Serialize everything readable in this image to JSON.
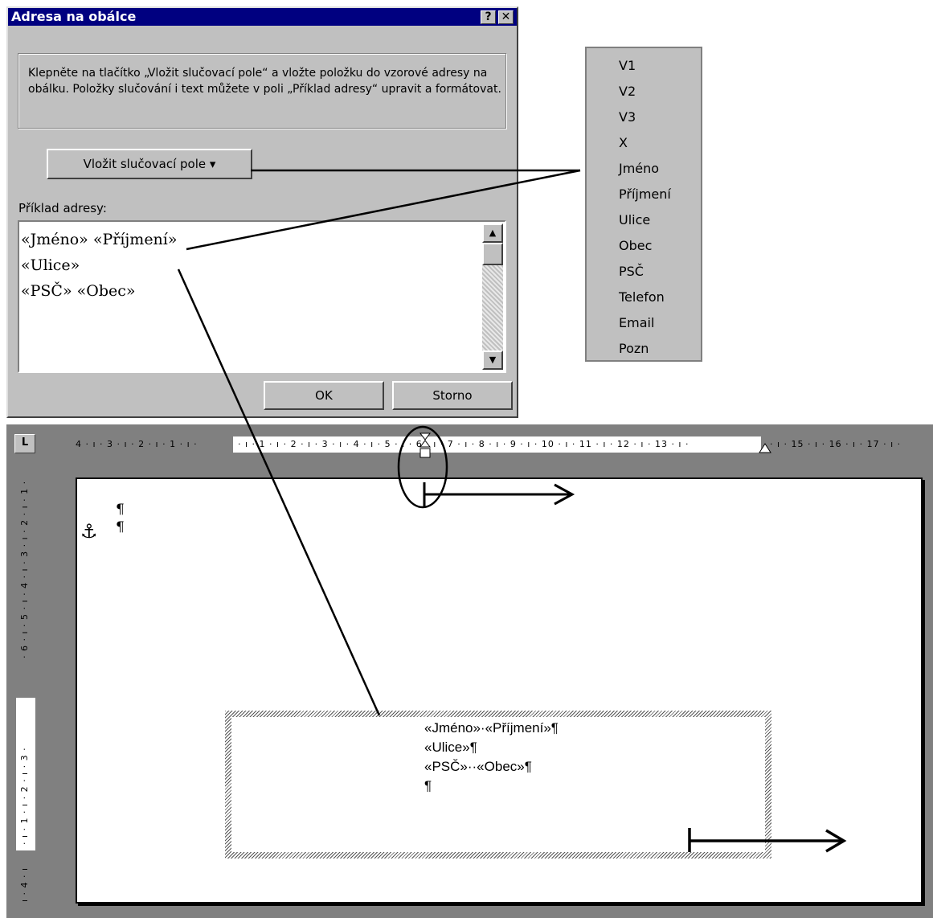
{
  "dialog": {
    "title": "Adresa na obálce",
    "help_button": "?",
    "close_button": "✕",
    "instructions": "Klepněte na tlačítko „Vložit slučovací pole“ a vložte položku do vzorové adresy na obálku. Položky slučování i text můžete v poli „Příklad adresy“ upravit a formátovat.",
    "merge_button": "Vložit slučovací pole ▾",
    "sample_label": "Příklad adresy:",
    "sample_lines": [
      "«Jméno» «Příjmení»",
      "«Ulice»",
      "«PSČ»  «Obec»"
    ],
    "ok": "OK",
    "cancel": "Storno"
  },
  "fields": [
    "V1",
    "V2",
    "V3",
    "X",
    "Jméno",
    "Příjmení",
    "Ulice",
    "Obec",
    "PSČ",
    "Telefon",
    "Email",
    "Pozn"
  ],
  "ruler": {
    "corner": "L",
    "left_labels": "4 · ı · 3 · ı · 2 · ı · 1 · ı ·",
    "white_labels": "· ı · 1 · ı · 2 · ı · 3 · ı · 4 · ı · 5 · ı · 6 · ı · 7 · ı · 8 · ı · 9 · ı · 10 · ı · 11 · ı · 12 · ı · 13 · ı ·",
    "right_labels": "· ı · 15 · ı · 16 · ı · 17 · ı ·",
    "vertical_top": "· 6 · ı · 5 · ı · 4 · ı · 3 · ı · 2 · ı · 1 ·",
    "vertical_white": "· ı · 1 · ı · 2 · ı · 3 ·",
    "vertical_bottom": "ı · 4 · ı"
  },
  "document": {
    "pilcrow_1": "¶",
    "pilcrow_2": "¶",
    "anchor": "⚓",
    "envelope_lines": [
      "«Jméno»·«Příjmení»¶",
      "«Ulice»¶",
      "«PSČ»··«Obec»¶",
      "¶"
    ]
  }
}
